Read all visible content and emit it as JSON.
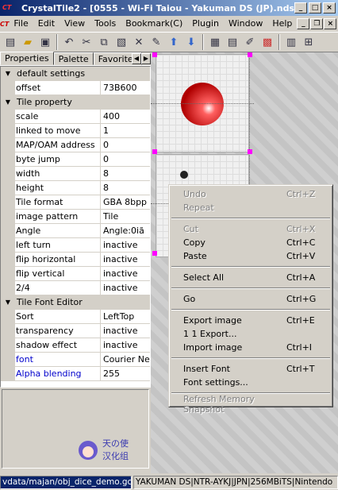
{
  "window": {
    "title": "CrystalTile2 - [0555 - Wi-Fi Taiou - Yakuman DS (JP).nds]",
    "app_icon": "CT"
  },
  "menubar": {
    "items": [
      "File",
      "Edit",
      "View",
      "Tools",
      "Bookmark(C)",
      "Plugin",
      "Window",
      "Help"
    ]
  },
  "toolbar": {
    "icons": [
      "open-file-icon",
      "open-folder-icon",
      "save-icon",
      "undo-icon",
      "cut-icon",
      "copy-icon",
      "paste-icon",
      "delete-icon",
      "settings-icon",
      "arrow-up-icon",
      "arrow-down-icon",
      "tile-view-icon",
      "text-view-icon",
      "edit-icon",
      "palette-icon",
      "memory-icon",
      "grid-icon"
    ]
  },
  "tabs": {
    "items": [
      "Properties",
      "Palette",
      "Favorites"
    ]
  },
  "properties": {
    "categories": [
      {
        "label": "default settings",
        "rows": [
          {
            "name": "offset",
            "value": "73B600"
          }
        ]
      },
      {
        "label": "Tile property",
        "rows": [
          {
            "name": "scale",
            "value": "400"
          },
          {
            "name": "linked to move",
            "value": "1"
          },
          {
            "name": "MAP/OAM address",
            "value": "0"
          },
          {
            "name": "byte jump",
            "value": "0"
          },
          {
            "name": "width",
            "value": "8"
          },
          {
            "name": "height",
            "value": "8"
          },
          {
            "name": "Tile format",
            "value": "GBA 8bpp"
          },
          {
            "name": "image pattern",
            "value": "Tile"
          },
          {
            "name": "Angle",
            "value": "Angle:0iã"
          },
          {
            "name": "left turn",
            "value": "inactive"
          },
          {
            "name": "flip horizontal",
            "value": "inactive"
          },
          {
            "name": "flip vertical",
            "value": "inactive"
          },
          {
            "name": "2/4",
            "value": "inactive"
          }
        ]
      },
      {
        "label": "Tile Font Editor",
        "rows": [
          {
            "name": "Sort",
            "value": "LeftTop"
          },
          {
            "name": "transparency",
            "value": "inactive"
          },
          {
            "name": "shadow effect",
            "value": "inactive"
          },
          {
            "name": "font",
            "value": "Courier New"
          },
          {
            "name": "Alpha blending",
            "value": "255"
          }
        ]
      }
    ]
  },
  "logo": {
    "text_top": "天の使",
    "text_bottom": "汉化组"
  },
  "context_menu": {
    "items": [
      {
        "label": "Undo",
        "shortcut": "Ctrl+Z",
        "disabled": true
      },
      {
        "label": "Repeat",
        "shortcut": "",
        "disabled": true
      },
      {
        "sep": true
      },
      {
        "label": "Cut",
        "shortcut": "Ctrl+X",
        "disabled": true
      },
      {
        "label": "Copy",
        "shortcut": "Ctrl+C",
        "disabled": false
      },
      {
        "label": "Paste",
        "shortcut": "Ctrl+V",
        "disabled": false
      },
      {
        "sep": true
      },
      {
        "label": "Select All",
        "shortcut": "Ctrl+A",
        "disabled": false
      },
      {
        "sep": true
      },
      {
        "label": "Go",
        "shortcut": "Ctrl+G",
        "disabled": false
      },
      {
        "sep": true
      },
      {
        "label": "Export image",
        "shortcut": "Ctrl+E",
        "disabled": false
      },
      {
        "label": "1 1 Export...",
        "shortcut": "",
        "disabled": false
      },
      {
        "label": "Import image",
        "shortcut": "Ctrl+I",
        "disabled": false
      },
      {
        "sep": true
      },
      {
        "label": "Insert Font",
        "shortcut": "Ctrl+T",
        "disabled": false
      },
      {
        "label": "Font settings...",
        "shortcut": "",
        "disabled": false
      },
      {
        "sep": true
      },
      {
        "label": "Refresh Memory Snapshot",
        "shortcut": "",
        "disabled": true
      }
    ]
  },
  "statusbar": {
    "path": "vdata/majan/obj_dice_demo.gcd",
    "info": "YAKUMAN DS|NTR-AYKJ|JPN|256MBiTS|Nintendo"
  }
}
